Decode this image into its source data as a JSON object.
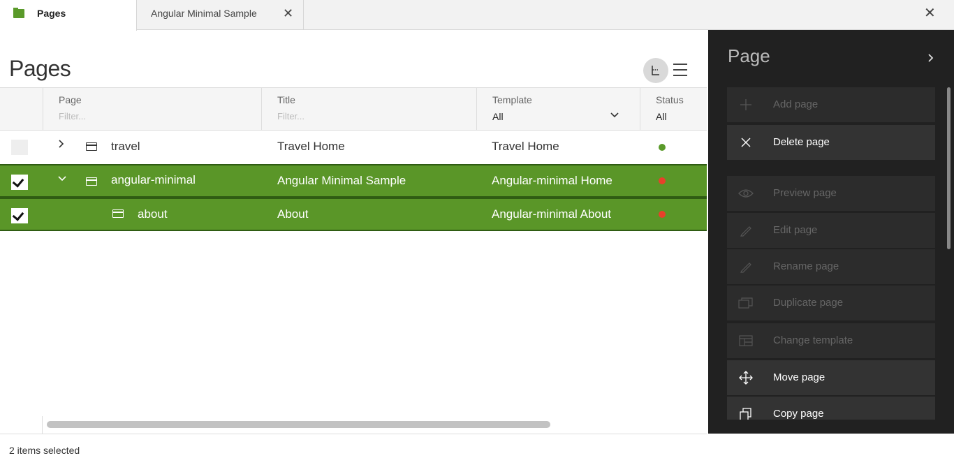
{
  "tabs": [
    {
      "label": "Pages"
    },
    {
      "label": "Angular Minimal Sample"
    }
  ],
  "main": {
    "title": "Pages"
  },
  "table": {
    "columns": [
      {
        "label": "Page",
        "filter_placeholder": "Filter..."
      },
      {
        "label": "Title",
        "filter_placeholder": "Filter..."
      },
      {
        "label": "Template",
        "value": "All"
      },
      {
        "label": "Status",
        "value": "All"
      }
    ],
    "rows": [
      {
        "page": "travel",
        "title": "Travel Home",
        "template": "Travel Home",
        "status_color": "#5a9a2a",
        "selected": false,
        "expander": "collapsed"
      },
      {
        "page": "angular-minimal",
        "title": "Angular Minimal Sample",
        "template": "Angular-minimal Home",
        "status_color": "#e8402a",
        "selected": true,
        "expander": "expanded"
      },
      {
        "page": "about",
        "title": "About",
        "template": "Angular-minimal About",
        "status_color": "#e8402a",
        "selected": true,
        "expander": "none"
      }
    ]
  },
  "status_bar": {
    "text": "2 items selected"
  },
  "panel": {
    "title": "Page",
    "actions": [
      {
        "label": "Add page",
        "icon": "plus-icon",
        "enabled": false
      },
      {
        "label": "Delete page",
        "icon": "close-icon",
        "enabled": true
      },
      {
        "label": "Preview page",
        "icon": "eye-icon",
        "enabled": false
      },
      {
        "label": "Edit page",
        "icon": "pencil-icon",
        "enabled": false
      },
      {
        "label": "Rename page",
        "icon": "pencil-icon",
        "enabled": false
      },
      {
        "label": "Duplicate page",
        "icon": "duplicate-icon",
        "enabled": false
      },
      {
        "label": "Change template",
        "icon": "template-icon",
        "enabled": false
      },
      {
        "label": "Move page",
        "icon": "move-icon",
        "enabled": true
      },
      {
        "label": "Copy page",
        "icon": "copy-icon",
        "enabled": true
      }
    ]
  },
  "colors": {
    "selected_row": "#5a9628",
    "panel_bg": "#212121",
    "brand_green": "#5a9a2a",
    "status_unpublished": "#e8402a"
  }
}
